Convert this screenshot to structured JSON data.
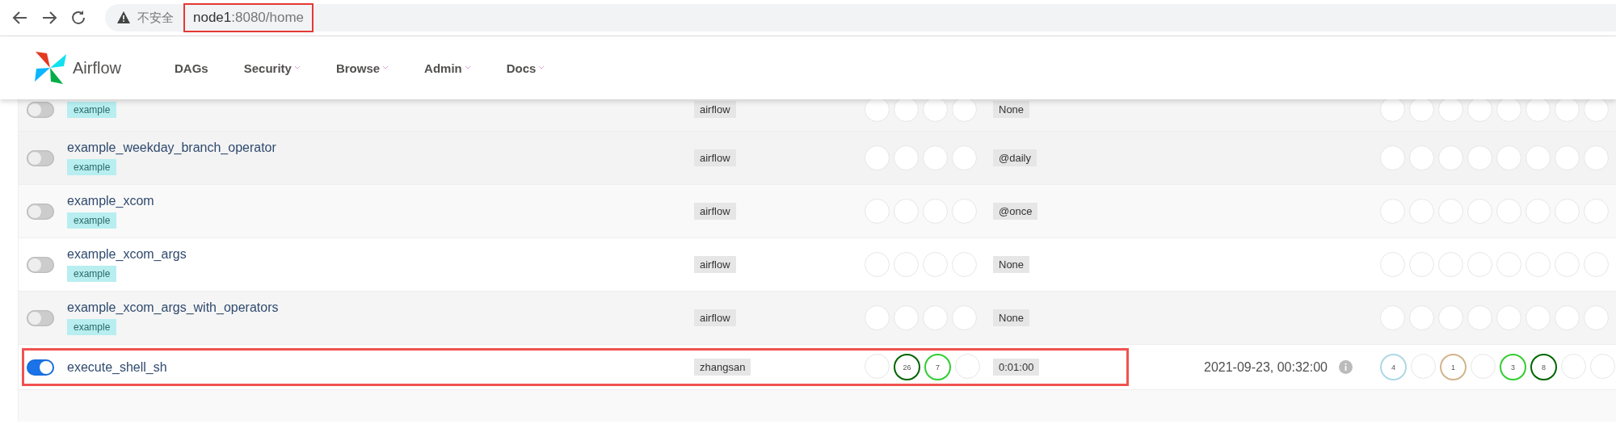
{
  "browser": {
    "security_label": "不安全",
    "url_host": "node1",
    "url_rest": ":8080/home",
    "url_highlighted": true
  },
  "nav": {
    "brand": "Airflow",
    "items": [
      {
        "label": "DAGs",
        "dropdown": false
      },
      {
        "label": "Security",
        "dropdown": true
      },
      {
        "label": "Browse",
        "dropdown": true
      },
      {
        "label": "Admin",
        "dropdown": true
      },
      {
        "label": "Docs",
        "dropdown": true
      }
    ]
  },
  "dags": [
    {
      "kind": "cut",
      "on": false,
      "tag": "example",
      "owner": "airflow",
      "schedule": "None",
      "highlighted": false,
      "runs": [
        {
          "kind": "empty"
        },
        {
          "kind": "empty"
        },
        {
          "kind": "empty"
        },
        {
          "kind": "empty"
        }
      ],
      "tasks": [
        {
          "kind": "empty"
        },
        {
          "kind": "empty"
        },
        {
          "kind": "empty"
        },
        {
          "kind": "empty"
        },
        {
          "kind": "empty"
        },
        {
          "kind": "empty"
        },
        {
          "kind": "empty"
        },
        {
          "kind": "empty"
        }
      ]
    },
    {
      "kind": "full",
      "on": false,
      "name": "example_weekday_branch_operator",
      "tag": "example",
      "owner": "airflow",
      "schedule": "@daily",
      "highlighted": false,
      "runs": [
        {
          "kind": "empty"
        },
        {
          "kind": "empty"
        },
        {
          "kind": "empty"
        },
        {
          "kind": "empty"
        }
      ],
      "tasks": [
        {
          "kind": "empty"
        },
        {
          "kind": "empty"
        },
        {
          "kind": "empty"
        },
        {
          "kind": "empty"
        },
        {
          "kind": "empty"
        },
        {
          "kind": "empty"
        },
        {
          "kind": "empty"
        },
        {
          "kind": "empty"
        }
      ]
    },
    {
      "kind": "full",
      "on": false,
      "name": "example_xcom",
      "tag": "example",
      "owner": "airflow",
      "schedule": "@once",
      "highlighted": false,
      "runs": [
        {
          "kind": "empty"
        },
        {
          "kind": "empty"
        },
        {
          "kind": "empty"
        },
        {
          "kind": "empty"
        }
      ],
      "tasks": [
        {
          "kind": "empty"
        },
        {
          "kind": "empty"
        },
        {
          "kind": "empty"
        },
        {
          "kind": "empty"
        },
        {
          "kind": "empty"
        },
        {
          "kind": "empty"
        },
        {
          "kind": "empty"
        },
        {
          "kind": "empty"
        }
      ]
    },
    {
      "kind": "full",
      "on": false,
      "name": "example_xcom_args",
      "tag": "example",
      "owner": "airflow",
      "schedule": "None",
      "highlighted": false,
      "runs": [
        {
          "kind": "empty"
        },
        {
          "kind": "empty"
        },
        {
          "kind": "empty"
        },
        {
          "kind": "empty"
        }
      ],
      "tasks": [
        {
          "kind": "empty"
        },
        {
          "kind": "empty"
        },
        {
          "kind": "empty"
        },
        {
          "kind": "empty"
        },
        {
          "kind": "empty"
        },
        {
          "kind": "empty"
        },
        {
          "kind": "empty"
        },
        {
          "kind": "empty"
        }
      ]
    },
    {
      "kind": "full",
      "on": false,
      "name": "example_xcom_args_with_operators",
      "tag": "example",
      "owner": "airflow",
      "schedule": "None",
      "highlighted": false,
      "runs": [
        {
          "kind": "empty"
        },
        {
          "kind": "empty"
        },
        {
          "kind": "empty"
        },
        {
          "kind": "empty"
        }
      ],
      "tasks": [
        {
          "kind": "empty"
        },
        {
          "kind": "empty"
        },
        {
          "kind": "empty"
        },
        {
          "kind": "empty"
        },
        {
          "kind": "empty"
        },
        {
          "kind": "empty"
        },
        {
          "kind": "empty"
        },
        {
          "kind": "empty"
        }
      ]
    },
    {
      "kind": "full",
      "on": true,
      "name": "execute_shell_sh",
      "owner": "zhangsan",
      "schedule": "0:01:00",
      "last_run": "2021-09-23, 00:32:00",
      "highlighted": true,
      "runs": [
        {
          "kind": "empty"
        },
        {
          "kind": "count",
          "text": "26",
          "color": "#006400"
        },
        {
          "kind": "count",
          "text": "7",
          "color": "#32cd32"
        },
        {
          "kind": "empty"
        }
      ],
      "tasks": [
        {
          "kind": "count",
          "text": "4",
          "color": "#add8e6"
        },
        {
          "kind": "empty"
        },
        {
          "kind": "count",
          "text": "1",
          "color": "#d2b48c"
        },
        {
          "kind": "empty"
        },
        {
          "kind": "count",
          "text": "3",
          "color": "#32cd32"
        },
        {
          "kind": "count",
          "text": "8",
          "color": "#006400"
        },
        {
          "kind": "empty"
        },
        {
          "kind": "empty"
        }
      ]
    }
  ]
}
